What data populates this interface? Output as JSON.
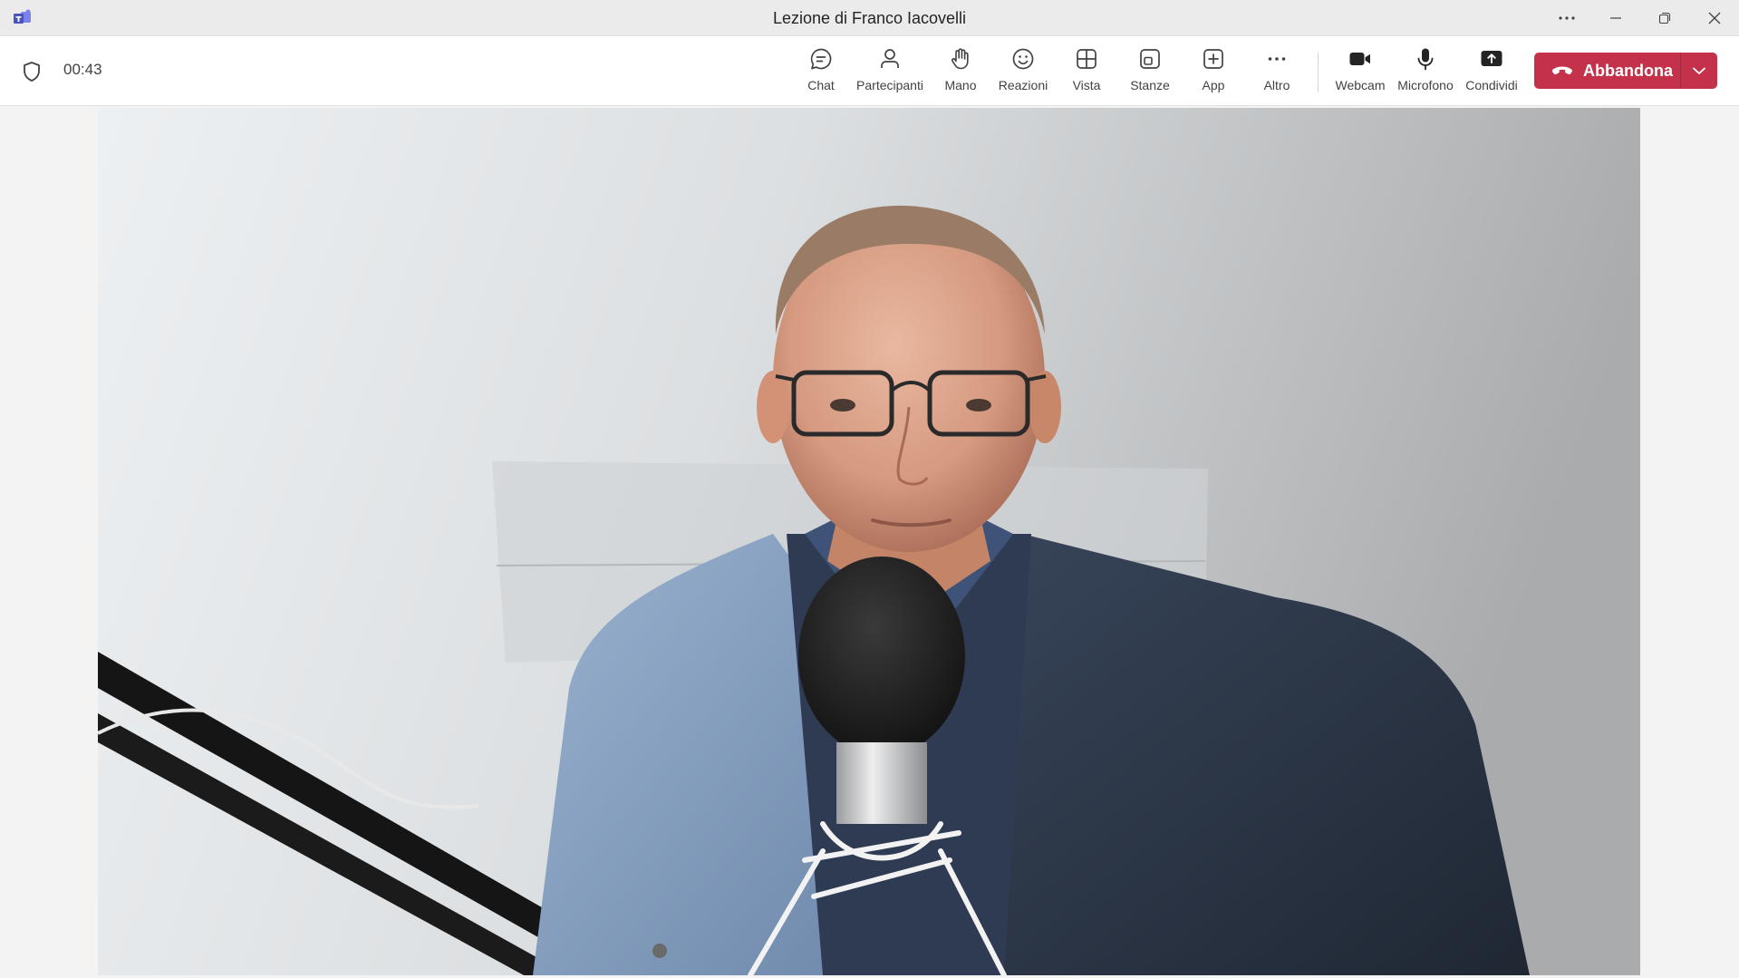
{
  "window": {
    "title": "Lezione di Franco Iacovelli",
    "controls": {
      "more_icon": "more-horizontal-icon",
      "minimize_icon": "minimize-icon",
      "restore_icon": "restore-icon",
      "close_icon": "close-icon"
    }
  },
  "meeting": {
    "timer": "00:43"
  },
  "toolbar": {
    "items": [
      {
        "label": "Chat",
        "icon": "chat-icon"
      },
      {
        "label": "Partecipanti",
        "icon": "people-icon"
      },
      {
        "label": "Mano",
        "icon": "raise-hand-icon"
      },
      {
        "label": "Reazioni",
        "icon": "emoji-icon"
      },
      {
        "label": "Vista",
        "icon": "view-grid-icon"
      },
      {
        "label": "Stanze",
        "icon": "breakout-rooms-icon"
      },
      {
        "label": "App",
        "icon": "add-app-icon"
      },
      {
        "label": "Altro",
        "icon": "more-icon"
      },
      {
        "label": "Webcam",
        "icon": "camera-icon"
      },
      {
        "label": "Microfono",
        "icon": "microphone-icon"
      },
      {
        "label": "Condividi",
        "icon": "share-screen-icon"
      }
    ],
    "leave_label": "Abbandona"
  },
  "colors": {
    "leave_button": "#c4314b",
    "teams_brand": "#5b5fc7"
  }
}
